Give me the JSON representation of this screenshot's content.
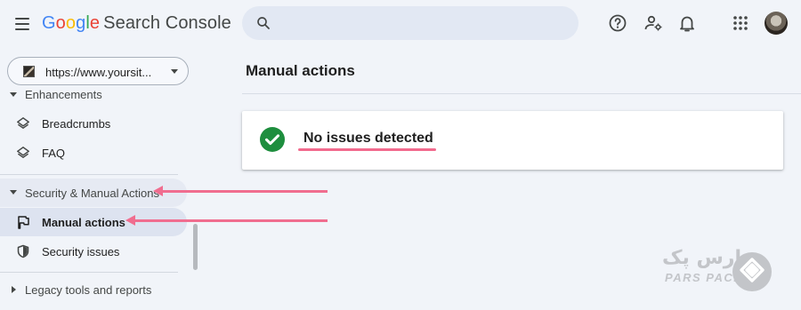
{
  "header": {
    "brand_google": [
      "G",
      "o",
      "o",
      "g",
      "l",
      "e"
    ],
    "brand_colors": [
      "#4285F4",
      "#EA4335",
      "#FBBC05",
      "#4285F4",
      "#34A853",
      "#EA4335"
    ],
    "brand_product": "Search Console",
    "search_placeholder": "",
    "icons": [
      "menu-icon",
      "search-icon",
      "help-icon",
      "manage-users-icon",
      "notifications-icon",
      "apps-icon",
      "avatar"
    ]
  },
  "property": {
    "url": "https://www.yoursit..."
  },
  "sidebar": {
    "enhancements_label": "Enhancements",
    "items": [
      {
        "label": "Breadcrumbs",
        "icon": "layers-icon"
      },
      {
        "label": "FAQ",
        "icon": "layers-icon"
      }
    ],
    "security_section_label": "Security & Manual Actions",
    "security_items": [
      {
        "label": "Manual actions",
        "icon": "flag-icon",
        "active": true
      },
      {
        "label": "Security issues",
        "icon": "shield-icon",
        "active": false
      }
    ],
    "legacy_label": "Legacy tools and reports"
  },
  "main": {
    "title": "Manual actions",
    "status_message": "No issues detected",
    "status_color": "#1e8e3e"
  },
  "annotation": {
    "arrow_color": "#f06d8f"
  },
  "watermark": {
    "text_fa": "پارس پک",
    "text_en": "PARS PACK"
  }
}
